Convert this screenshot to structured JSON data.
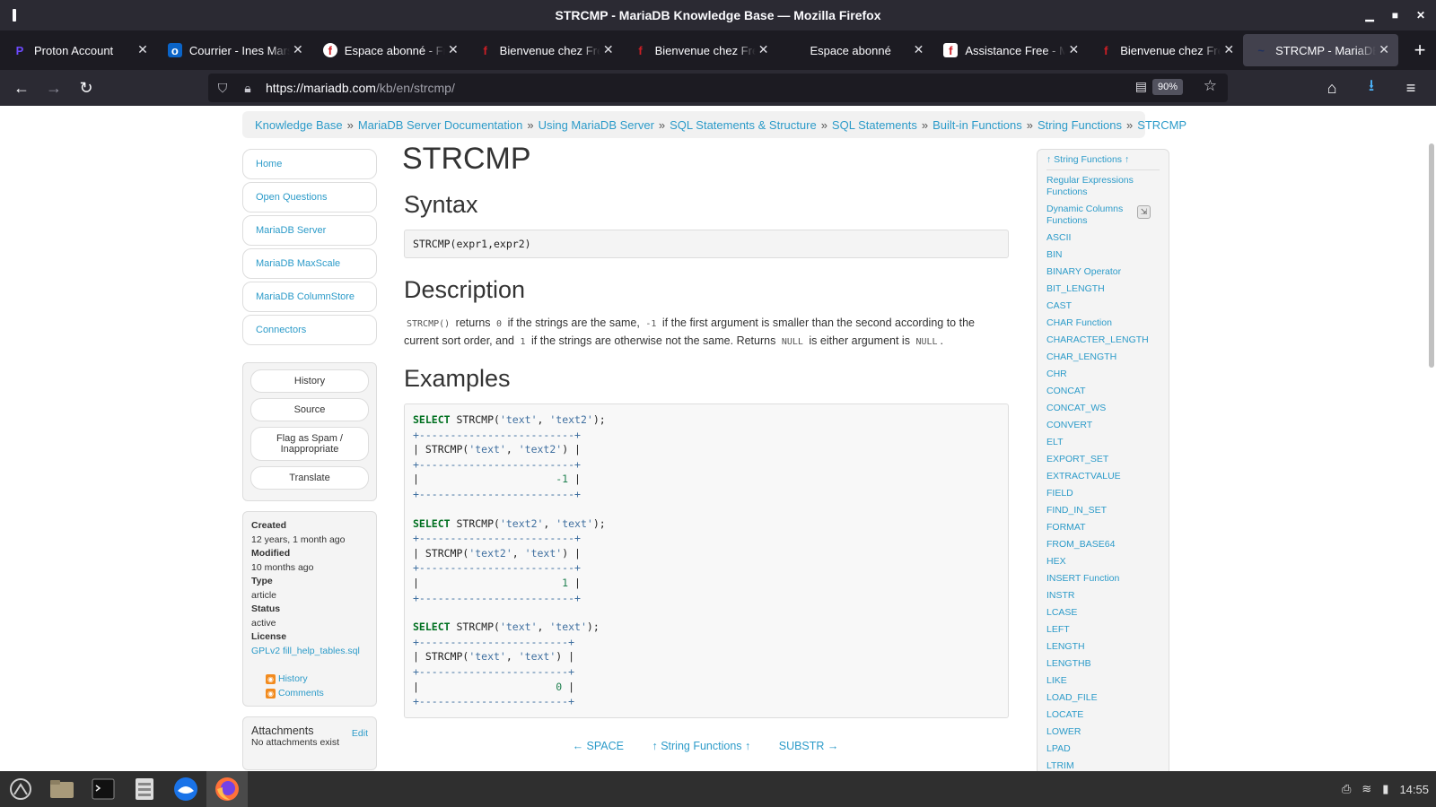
{
  "window": {
    "title": "STRCMP - MariaDB Knowledge Base — Mozilla Firefox"
  },
  "tabs": [
    {
      "label": "Proton Account",
      "favicon": "proton-icon",
      "color": "#6d4aff",
      "glyph": "P",
      "active": false
    },
    {
      "label": "Courrier - Ines Marsh",
      "favicon": "outlook-icon",
      "color": "#0a64c8",
      "glyph": "o",
      "active": false
    },
    {
      "label": "Espace abonné - Free",
      "favicon": "free-icon",
      "color": "#cd1e25",
      "glyph": "f",
      "active": false
    },
    {
      "label": "Bienvenue chez Free",
      "favicon": "free-icon",
      "color": "#cd1e25",
      "glyph": "f",
      "active": false
    },
    {
      "label": "Bienvenue chez Free",
      "favicon": "free-icon",
      "color": "#cd1e25",
      "glyph": "f",
      "active": false
    },
    {
      "label": "Espace abonné",
      "favicon": "",
      "color": "",
      "glyph": "",
      "active": false
    },
    {
      "label": "Assistance Free - Mes",
      "favicon": "free-icon",
      "color": "#cd1e25",
      "glyph": "f",
      "active": false
    },
    {
      "label": "Bienvenue chez Free",
      "favicon": "free-icon",
      "color": "#cd1e25",
      "glyph": "f",
      "active": false
    },
    {
      "label": "STRCMP - MariaDB",
      "favicon": "mariadb-icon",
      "color": "#1f305f",
      "glyph": "~",
      "active": true
    }
  ],
  "navbar": {
    "url_host": "https://mariadb.com",
    "url_path": "/kb/en/strcmp/",
    "zoom": "90%"
  },
  "breadcrumb": [
    "Knowledge Base",
    "MariaDB Server Documentation",
    "Using MariaDB Server",
    "SQL Statements & Structure",
    "SQL Statements",
    "Built-in Functions",
    "String Functions",
    "STRCMP"
  ],
  "leftnav": [
    "Home",
    "Open Questions",
    "MariaDB Server",
    "MariaDB MaxScale",
    "MariaDB ColumnStore",
    "Connectors"
  ],
  "actions": [
    "History",
    "Source",
    "Flag as Spam / Inappropriate",
    "Translate"
  ],
  "meta": {
    "created_label": "Created",
    "created": "12 years, 1 month ago",
    "modified_label": "Modified",
    "modified": "10 months ago",
    "type_label": "Type",
    "type": "article",
    "status_label": "Status",
    "status": "active",
    "license_label": "License",
    "license": "GPLv2 fill_help_tables.sql",
    "feed_history": "History",
    "feed_comments": "Comments"
  },
  "attachments": {
    "title": "Attachments",
    "edit": "Edit",
    "empty": "No attachments exist"
  },
  "main": {
    "title": "STRCMP",
    "syntax_heading": "Syntax",
    "syntax": "STRCMP(expr1,expr2)",
    "description_heading": "Description",
    "desc": {
      "code_fn": "STRCMP()",
      "t1": "returns",
      "code_0": "0",
      "t2": "if the strings are the same,",
      "code_m1": "-1",
      "t3": "if the first argument is smaller than the second according to the current sort order, and",
      "code_1": "1",
      "t4": "if the strings are otherwise not the same. Returns",
      "code_null": "NULL",
      "t5": "is either argument is",
      "code_null2": "NULL",
      "t6": "."
    },
    "examples_heading": "Examples",
    "examples": [
      {
        "kw": "SELECT",
        "fn": "STRCMP(",
        "a": "'text'",
        "b": "'text2'",
        "end": ");",
        "border": "+-------------------------+",
        "col_a": "'text'",
        "col_b": "'text2'",
        "result": "-1"
      },
      {
        "kw": "SELECT",
        "fn": "STRCMP(",
        "a": "'text2'",
        "b": "'text'",
        "end": ");",
        "border": "+-------------------------+",
        "col_a": "'text2'",
        "col_b": "'text'",
        "result": "1"
      },
      {
        "kw": "SELECT",
        "fn": "STRCMP(",
        "a": "'text'",
        "b": "'text'",
        "end": ");",
        "border": "+------------------------+",
        "col_a": "'text'",
        "col_b": "'text'",
        "result": "0"
      }
    ],
    "pager": {
      "prev": "← SPACE",
      "up": "↑ String Functions ↑",
      "next": "SUBSTR →"
    }
  },
  "rightnav": {
    "up": "↑ String Functions ↑",
    "items": [
      "Regular Expressions Functions",
      "Dynamic Columns Functions",
      "ASCII",
      "BIN",
      "BINARY Operator",
      "BIT_LENGTH",
      "CAST",
      "CHAR Function",
      "CHARACTER_LENGTH",
      "CHAR_LENGTH",
      "CHR",
      "CONCAT",
      "CONCAT_WS",
      "CONVERT",
      "ELT",
      "EXPORT_SET",
      "EXTRACTVALUE",
      "FIELD",
      "FIND_IN_SET",
      "FORMAT",
      "FROM_BASE64",
      "HEX",
      "INSERT Function",
      "INSTR",
      "LCASE",
      "LEFT",
      "LENGTH",
      "LENGTHB",
      "LIKE",
      "LOAD_FILE",
      "LOCATE",
      "LOWER",
      "LPAD",
      "LTRIM"
    ]
  },
  "taskbar": {
    "apps": [
      "start-menu-icon",
      "file-manager-icon",
      "terminal-icon",
      "files-icon",
      "thunderbird-icon",
      "firefox-icon"
    ],
    "clock": "14:55"
  }
}
